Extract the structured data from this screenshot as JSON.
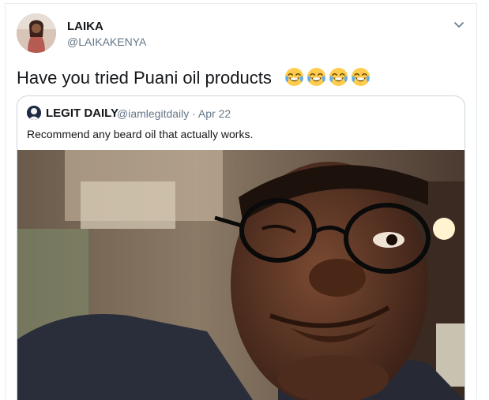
{
  "tweet": {
    "display_name": "LAIKA",
    "handle": "@LAIKAKENYA",
    "text": "Have you tried Puani oil products",
    "emoji": [
      "face-with-tears-of-joy",
      "face-with-tears-of-joy",
      "face-with-tears-of-joy",
      "face-with-tears-of-joy"
    ],
    "menu_icon": "chevron-down-icon"
  },
  "quoted": {
    "display_name": "LEGIT DAILY",
    "handle_date": "@iamlegitdaily · Apr 22",
    "text": "Recommend any beard oil that actually works."
  },
  "colors": {
    "text": "#14171a",
    "muted": "#657786",
    "border": "#ccd6dd"
  }
}
